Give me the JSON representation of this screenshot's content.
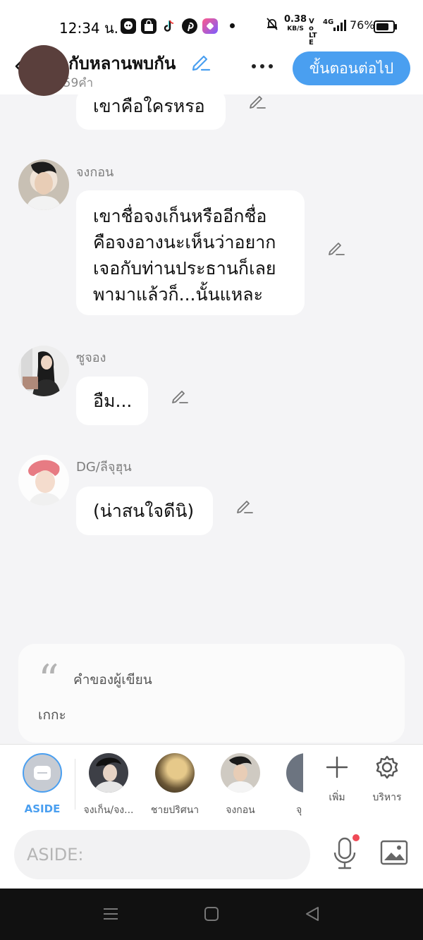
{
  "status_bar": {
    "time": "12:34 น.",
    "net_speed": "0.38",
    "net_unit": "KB/S",
    "volte": "Vo LTE",
    "signal": "4G",
    "battery": "76%",
    "battery_level": 0.76
  },
  "header": {
    "title": "ตากับหลานพบกัน",
    "word_count": "3159คำ",
    "next_button": "ขั้นตอนต่อไป"
  },
  "messages": [
    {
      "name": "",
      "text": "เขาคือใครหรอ"
    },
    {
      "name": "จงกอน",
      "text": "เขาชื่อจงเก็นหรืออีกชื่อ\nคือจงอางนะเห็นว่าอยาก\nเจอกับท่านประธานก็เลย\nพามาแล้วก็...นั้นแหละ"
    },
    {
      "name": "ซูจอง",
      "text": "อืม..."
    },
    {
      "name": "DG/ลีจุฮุน",
      "text": "(น่าสนใจดีนิ)"
    }
  ],
  "writer_note": {
    "label": "คำของผู้เขียน",
    "text": "เกกะ"
  },
  "characters": [
    {
      "label": "ASIDE"
    },
    {
      "label": "จงเก็น/จง..."
    },
    {
      "label": "ชายปริศนา"
    },
    {
      "label": "จงกอน"
    },
    {
      "label": "จุ"
    }
  ],
  "tools": {
    "add": "เพิ่ม",
    "manage": "บริหาร"
  },
  "input": {
    "placeholder": "ASIDE:"
  },
  "colors": {
    "accent": "#4a9ff0",
    "background": "#f4f4f6",
    "bubble": "#ffffff",
    "record_dot": "#ef4a57"
  }
}
